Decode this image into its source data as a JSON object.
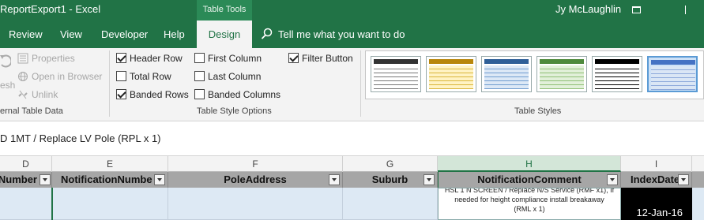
{
  "window": {
    "title": "ReportExport1  -  Excel",
    "context_tab": "Table Tools",
    "user": "Jy McLaughlin"
  },
  "ribbon_tabs": {
    "review": "Review",
    "view": "View",
    "developer": "Developer",
    "help": "Help",
    "design": "Design",
    "tell_me": "Tell me what you want to do"
  },
  "ribbon": {
    "external": {
      "refresh": "esh",
      "properties": "Properties",
      "open_in_browser": "Open in Browser",
      "unlink": "Unlink",
      "group_label": "ernal Table Data"
    },
    "style_options": {
      "header_row": {
        "label": "Header Row",
        "checked": true
      },
      "total_row": {
        "label": "Total Row",
        "checked": false
      },
      "banded_rows": {
        "label": "Banded Rows",
        "checked": true
      },
      "first_column": {
        "label": "First Column",
        "checked": false
      },
      "last_column": {
        "label": "Last Column",
        "checked": false
      },
      "banded_columns": {
        "label": "Banded Columns",
        "checked": false
      },
      "filter_button": {
        "label": "Filter Button",
        "checked": true
      },
      "group_label": "Table Style Options"
    },
    "table_styles": {
      "group_label": "Table Styles",
      "swatches": [
        {
          "name": "style-light-1",
          "header": "#333333",
          "row": "#ffffff",
          "line": "#777777"
        },
        {
          "name": "style-yellow",
          "header": "#b8860b",
          "row": "#fff3c4",
          "line": "#d9b53a"
        },
        {
          "name": "style-blue",
          "header": "#2f5f98",
          "row": "#dce8f6",
          "line": "#6f9ccf"
        },
        {
          "name": "style-green",
          "header": "#4e8a3c",
          "row": "#e2f0d9",
          "line": "#8fbf74"
        },
        {
          "name": "style-dark",
          "header": "#000000",
          "row": "#ffffff",
          "line": "#000000"
        },
        {
          "name": "style-selected-blue",
          "header": "#4472c4",
          "row": "#dae6f5",
          "line": "#8eaadb"
        }
      ]
    }
  },
  "formula_bar": {
    "content": "D 1MT /  Replace LV Pole (RPL x 1)"
  },
  "columns": [
    "D",
    "E",
    "F",
    "G",
    "H",
    "I"
  ],
  "table_header": {
    "d": "Number",
    "e": "NotificationNumbe",
    "f": "PoleAddress",
    "g": "Suburb",
    "h": "NotificationComment",
    "i": "IndexDate"
  },
  "row": {
    "comment_line1": "HSL 1 N SCREEN / Replace N/S Service (RMF x1), If",
    "comment_line2": "needed for height compliance install breakaway",
    "comment_line3": "(RML x 1)",
    "index_date": "12-Jan-16"
  }
}
